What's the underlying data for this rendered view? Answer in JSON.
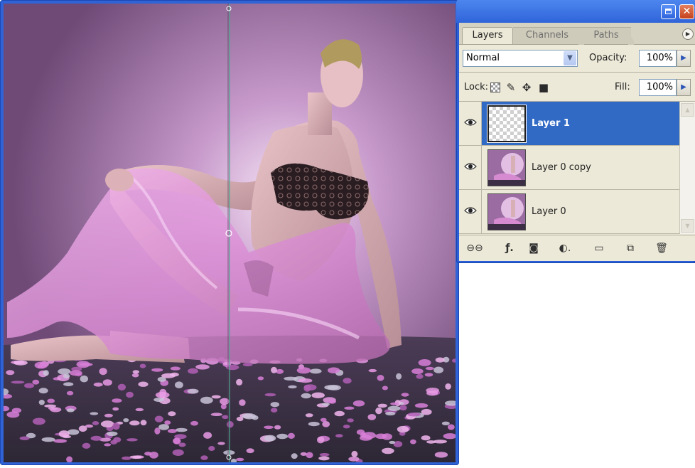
{
  "palette": {
    "tabs": [
      {
        "label": "Layers",
        "active": true
      },
      {
        "label": "Channels",
        "active": false
      },
      {
        "label": "Paths",
        "active": false
      }
    ],
    "blend_mode": "Normal",
    "opacity_label": "Opacity:",
    "opacity_value": "100%",
    "lock_label": "Lock:",
    "fill_label": "Fill:",
    "fill_value": "100%",
    "layers": [
      {
        "name": "Layer 1",
        "visible": true,
        "selected": true,
        "thumbnail": "transparent"
      },
      {
        "name": "Layer 0 copy",
        "visible": true,
        "selected": false,
        "thumbnail": "photo"
      },
      {
        "name": "Layer 0",
        "visible": true,
        "selected": false,
        "thumbnail": "photo"
      }
    ],
    "bottom_icons": [
      "link-icon",
      "layer-style-icon",
      "layer-mask-icon",
      "adjustment-layer-icon",
      "new-group-icon",
      "new-layer-icon",
      "trash-icon"
    ]
  },
  "colors": {
    "window_blue": "#2f63d6",
    "selection_blue": "#316ac5",
    "panel_bg": "#ece9d8",
    "background_purple": "#8e6a94",
    "fabric_pink": "#e7a0e0"
  }
}
